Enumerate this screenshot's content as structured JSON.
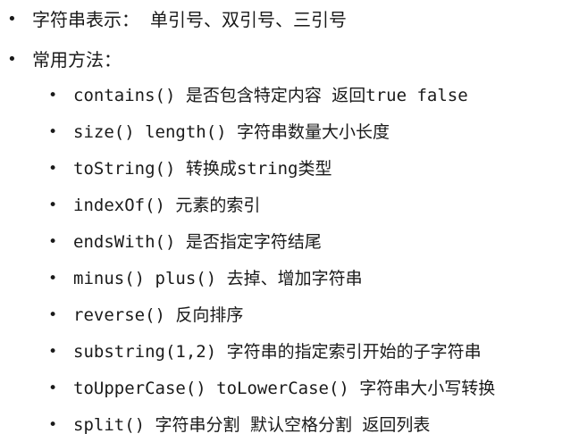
{
  "bullet_glyph": "•",
  "items": [
    {
      "text": "字符串表示： 单引号、双引号、三引号"
    },
    {
      "text": "常用方法："
    }
  ],
  "methods": [
    {
      "text": "contains() 是否包含特定内容  返回true false"
    },
    {
      "text": "size() length() 字符串数量大小长度"
    },
    {
      "text": "toString() 转换成string类型"
    },
    {
      "text": "indexOf() 元素的索引"
    },
    {
      "text": "endsWith()  是否指定字符结尾"
    },
    {
      "text": "minus() plus()  去掉、增加字符串"
    },
    {
      "text": "reverse()  反向排序"
    },
    {
      "text": "substring(1,2) 字符串的指定索引开始的子字符串"
    },
    {
      "text": "toUpperCase() toLowerCase()  字符串大小写转换"
    },
    {
      "text": "split() 字符串分割 默认空格分割  返回列表"
    }
  ]
}
